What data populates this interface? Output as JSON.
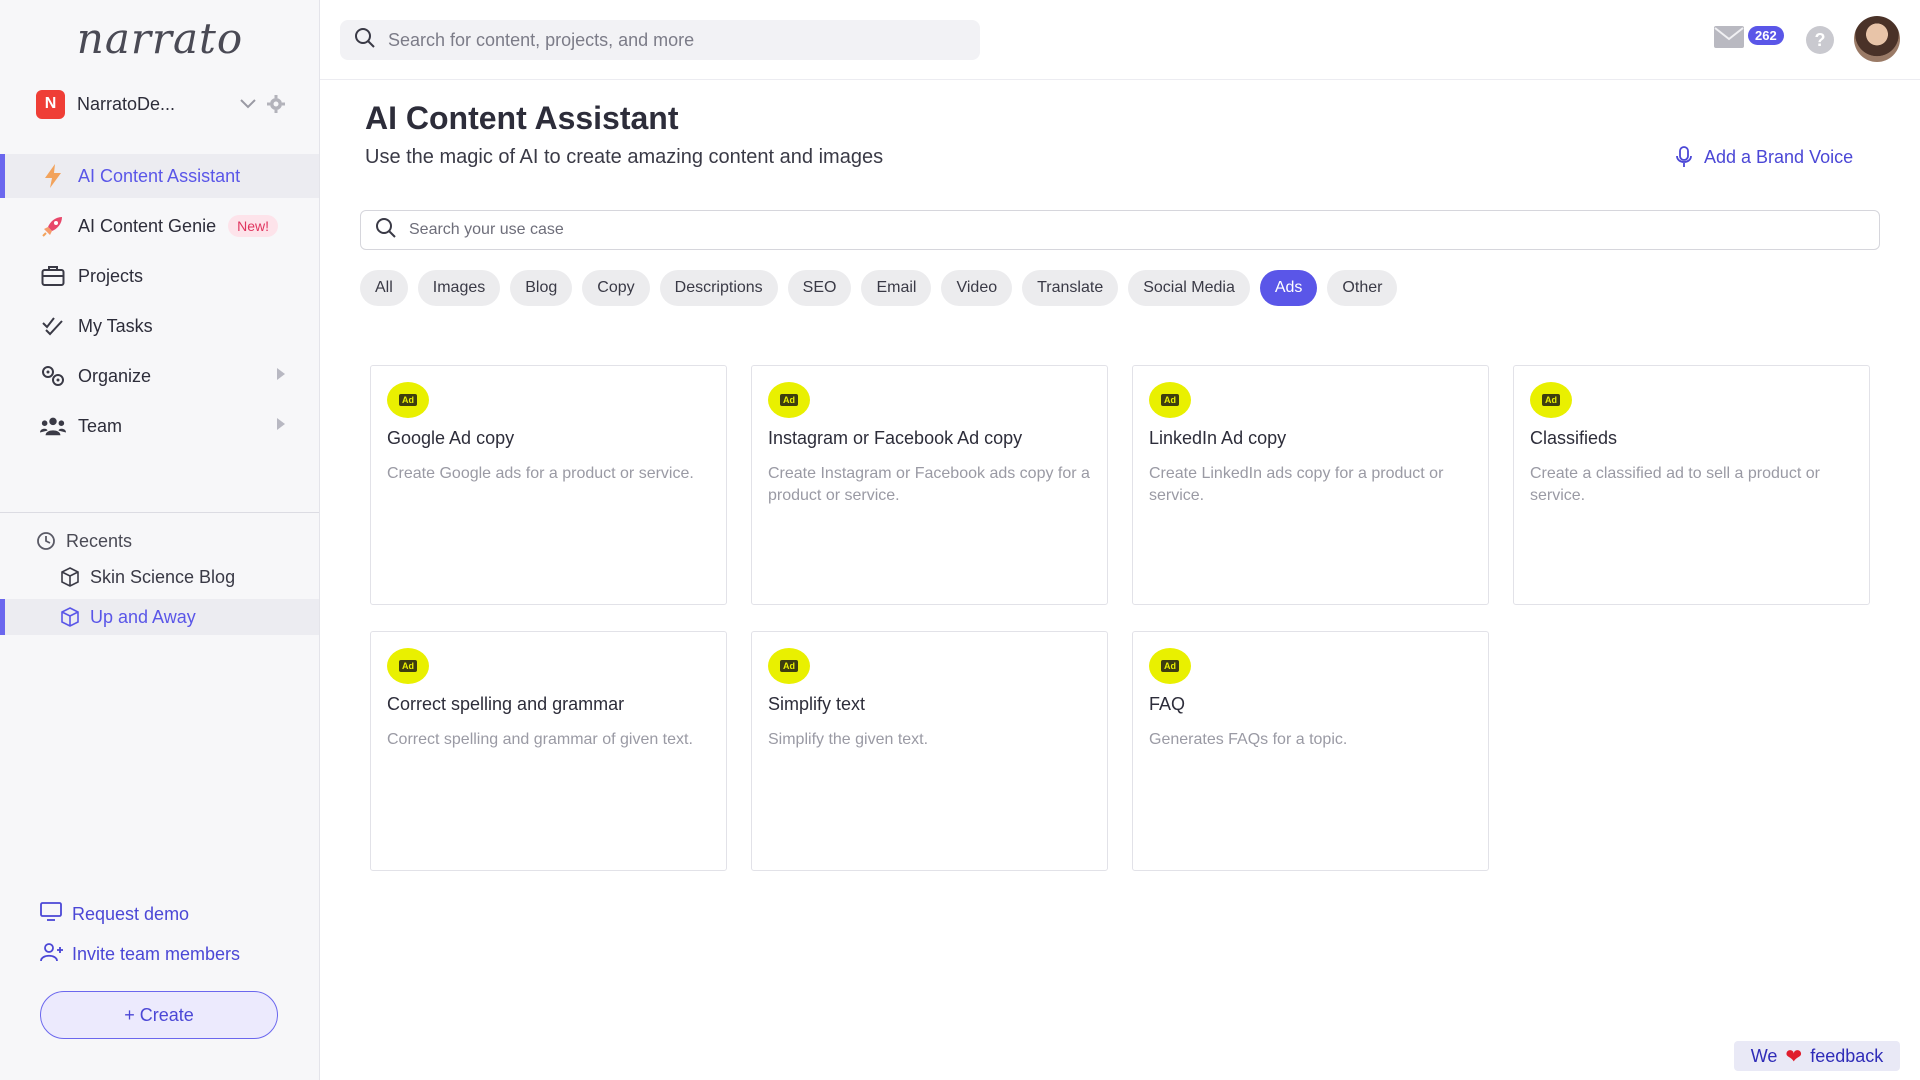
{
  "app": {
    "logo_text": "narrato"
  },
  "workspace": {
    "initial": "N",
    "name": "NarratoDe..."
  },
  "sidebar": {
    "items": [
      {
        "label": "AI Content Assistant",
        "icon": "bolt-icon",
        "active": true
      },
      {
        "label": "AI Content Genie",
        "icon": "rocket-icon",
        "badge": "New!"
      },
      {
        "label": "Projects",
        "icon": "briefcase-icon"
      },
      {
        "label": "My Tasks",
        "icon": "checkmarks-icon"
      },
      {
        "label": "Organize",
        "icon": "gears-icon",
        "expandable": true
      },
      {
        "label": "Team",
        "icon": "team-icon",
        "expandable": true
      }
    ],
    "recents_title": "Recents",
    "recents": [
      {
        "label": "Skin Science Blog",
        "icon": "cube-icon"
      },
      {
        "label": "Up and Away",
        "icon": "cube-icon",
        "active": true
      }
    ],
    "request_demo": "Request demo",
    "invite_members": "Invite team members",
    "create_label": "+ Create"
  },
  "topbar": {
    "search_placeholder": "Search for content, projects, and more",
    "mail_count": "262",
    "help_label": "?"
  },
  "main": {
    "title": "AI Content Assistant",
    "subtitle": "Use the magic of AI to create amazing content and images",
    "brand_voice": "Add a Brand Voice",
    "usecase_placeholder": "Search your use case",
    "chips": [
      "All",
      "Images",
      "Blog",
      "Copy",
      "Descriptions",
      "SEO",
      "Email",
      "Video",
      "Translate",
      "Social Media",
      "Ads",
      "Other"
    ],
    "active_chip": "Ads",
    "card_icon_text": "Ad",
    "cards": [
      {
        "title": "Google Ad copy",
        "desc": "Create Google ads for a product or service."
      },
      {
        "title": "Instagram or Facebook Ad copy",
        "desc": "Create Instagram or Facebook ads copy for a product or service."
      },
      {
        "title": "LinkedIn Ad copy",
        "desc": "Create LinkedIn ads copy for a product or service."
      },
      {
        "title": "Classifieds",
        "desc": "Create a classified ad to sell a product or service."
      },
      {
        "title": "Correct spelling and grammar",
        "desc": "Correct spelling and grammar of given text."
      },
      {
        "title": "Simplify text",
        "desc": "Simplify the given text."
      },
      {
        "title": "FAQ",
        "desc": "Generates FAQs for a topic."
      }
    ]
  },
  "feedback": {
    "prefix": "We",
    "heart": "❤",
    "suffix": "feedback"
  },
  "colors": {
    "accent": "#5a56e8",
    "ad_icon": "#e9f000",
    "brand_red": "#ef3e36"
  }
}
